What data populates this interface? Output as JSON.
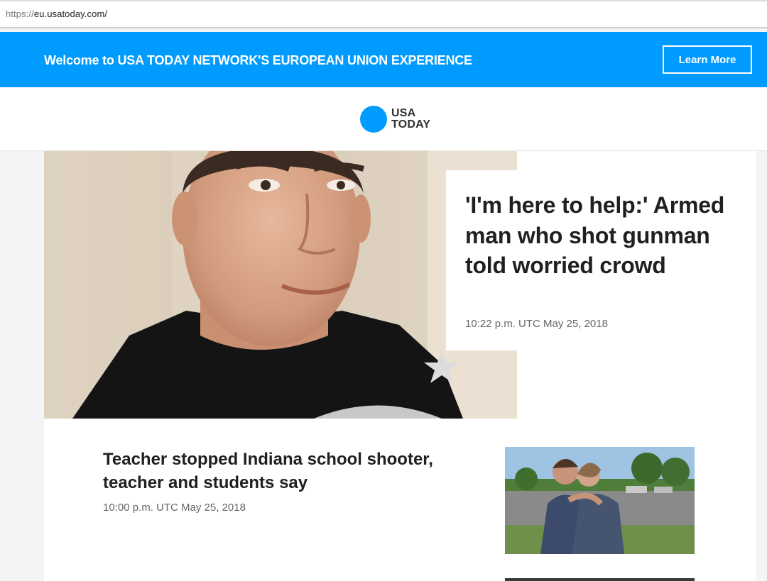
{
  "browser": {
    "url_scheme": "https://",
    "url_rest": "eu.usatoday.com/"
  },
  "banner": {
    "text": "Welcome to USA TODAY NETWORK'S EUROPEAN UNION EXPERIENCE",
    "button_label": "Learn More",
    "background_color": "#009bff"
  },
  "logo": {
    "line1": "USA",
    "line2": "TODAY",
    "dot_color": "#009bff"
  },
  "hero": {
    "headline": "'I'm here to help:' Armed man who shot gunman told worried crowd",
    "timestamp": "10:22 p.m. UTC May 25, 2018"
  },
  "stories": [
    {
      "headline": "Teacher stopped Indiana school shooter, teacher and students say",
      "timestamp": "10:00 p.m. UTC May 25, 2018"
    }
  ]
}
